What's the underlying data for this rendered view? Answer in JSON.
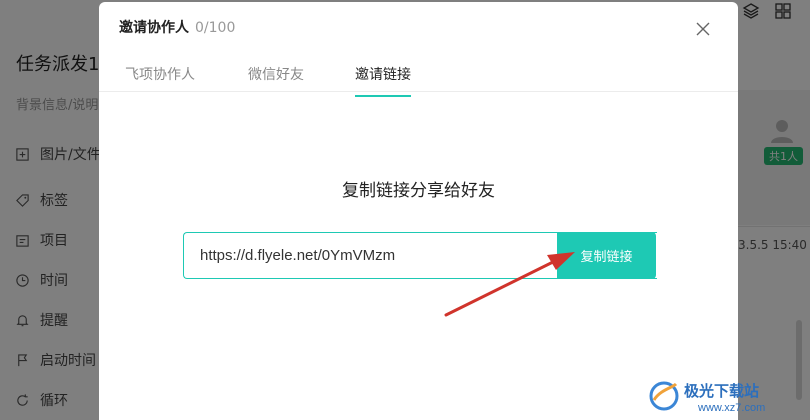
{
  "background": {
    "title": "任务派发1",
    "description": "背景信息/说明",
    "fields": [
      {
        "label": "图片/文件",
        "icon": "plus-square-icon"
      },
      {
        "label": "标签",
        "icon": "tag-icon"
      },
      {
        "label": "项目",
        "icon": "folder-icon"
      },
      {
        "label": "时间",
        "icon": "clock-icon"
      },
      {
        "label": "提醒",
        "icon": "bell-icon"
      },
      {
        "label": "启动时间",
        "icon": "flag-icon"
      },
      {
        "label": "循环",
        "icon": "cycle-icon"
      }
    ],
    "members_badge": "共1人",
    "timestamp": "3.5.5 15:40"
  },
  "modal": {
    "title": "邀请协作人",
    "count": "0/100",
    "tabs": [
      {
        "label": "飞项协作人",
        "active": false
      },
      {
        "label": "微信好友",
        "active": false
      },
      {
        "label": "邀请链接",
        "active": true
      }
    ],
    "share_heading": "复制链接分享给好友",
    "link_value": "https://d.flyele.net/0YmVMzm",
    "copy_button": "复制链接"
  },
  "watermark": {
    "text": "极光下载站",
    "url": "www.xz7.com"
  },
  "colors": {
    "accent": "#1ec9b4",
    "badge": "#25b873",
    "arrow": "#d0342c"
  }
}
